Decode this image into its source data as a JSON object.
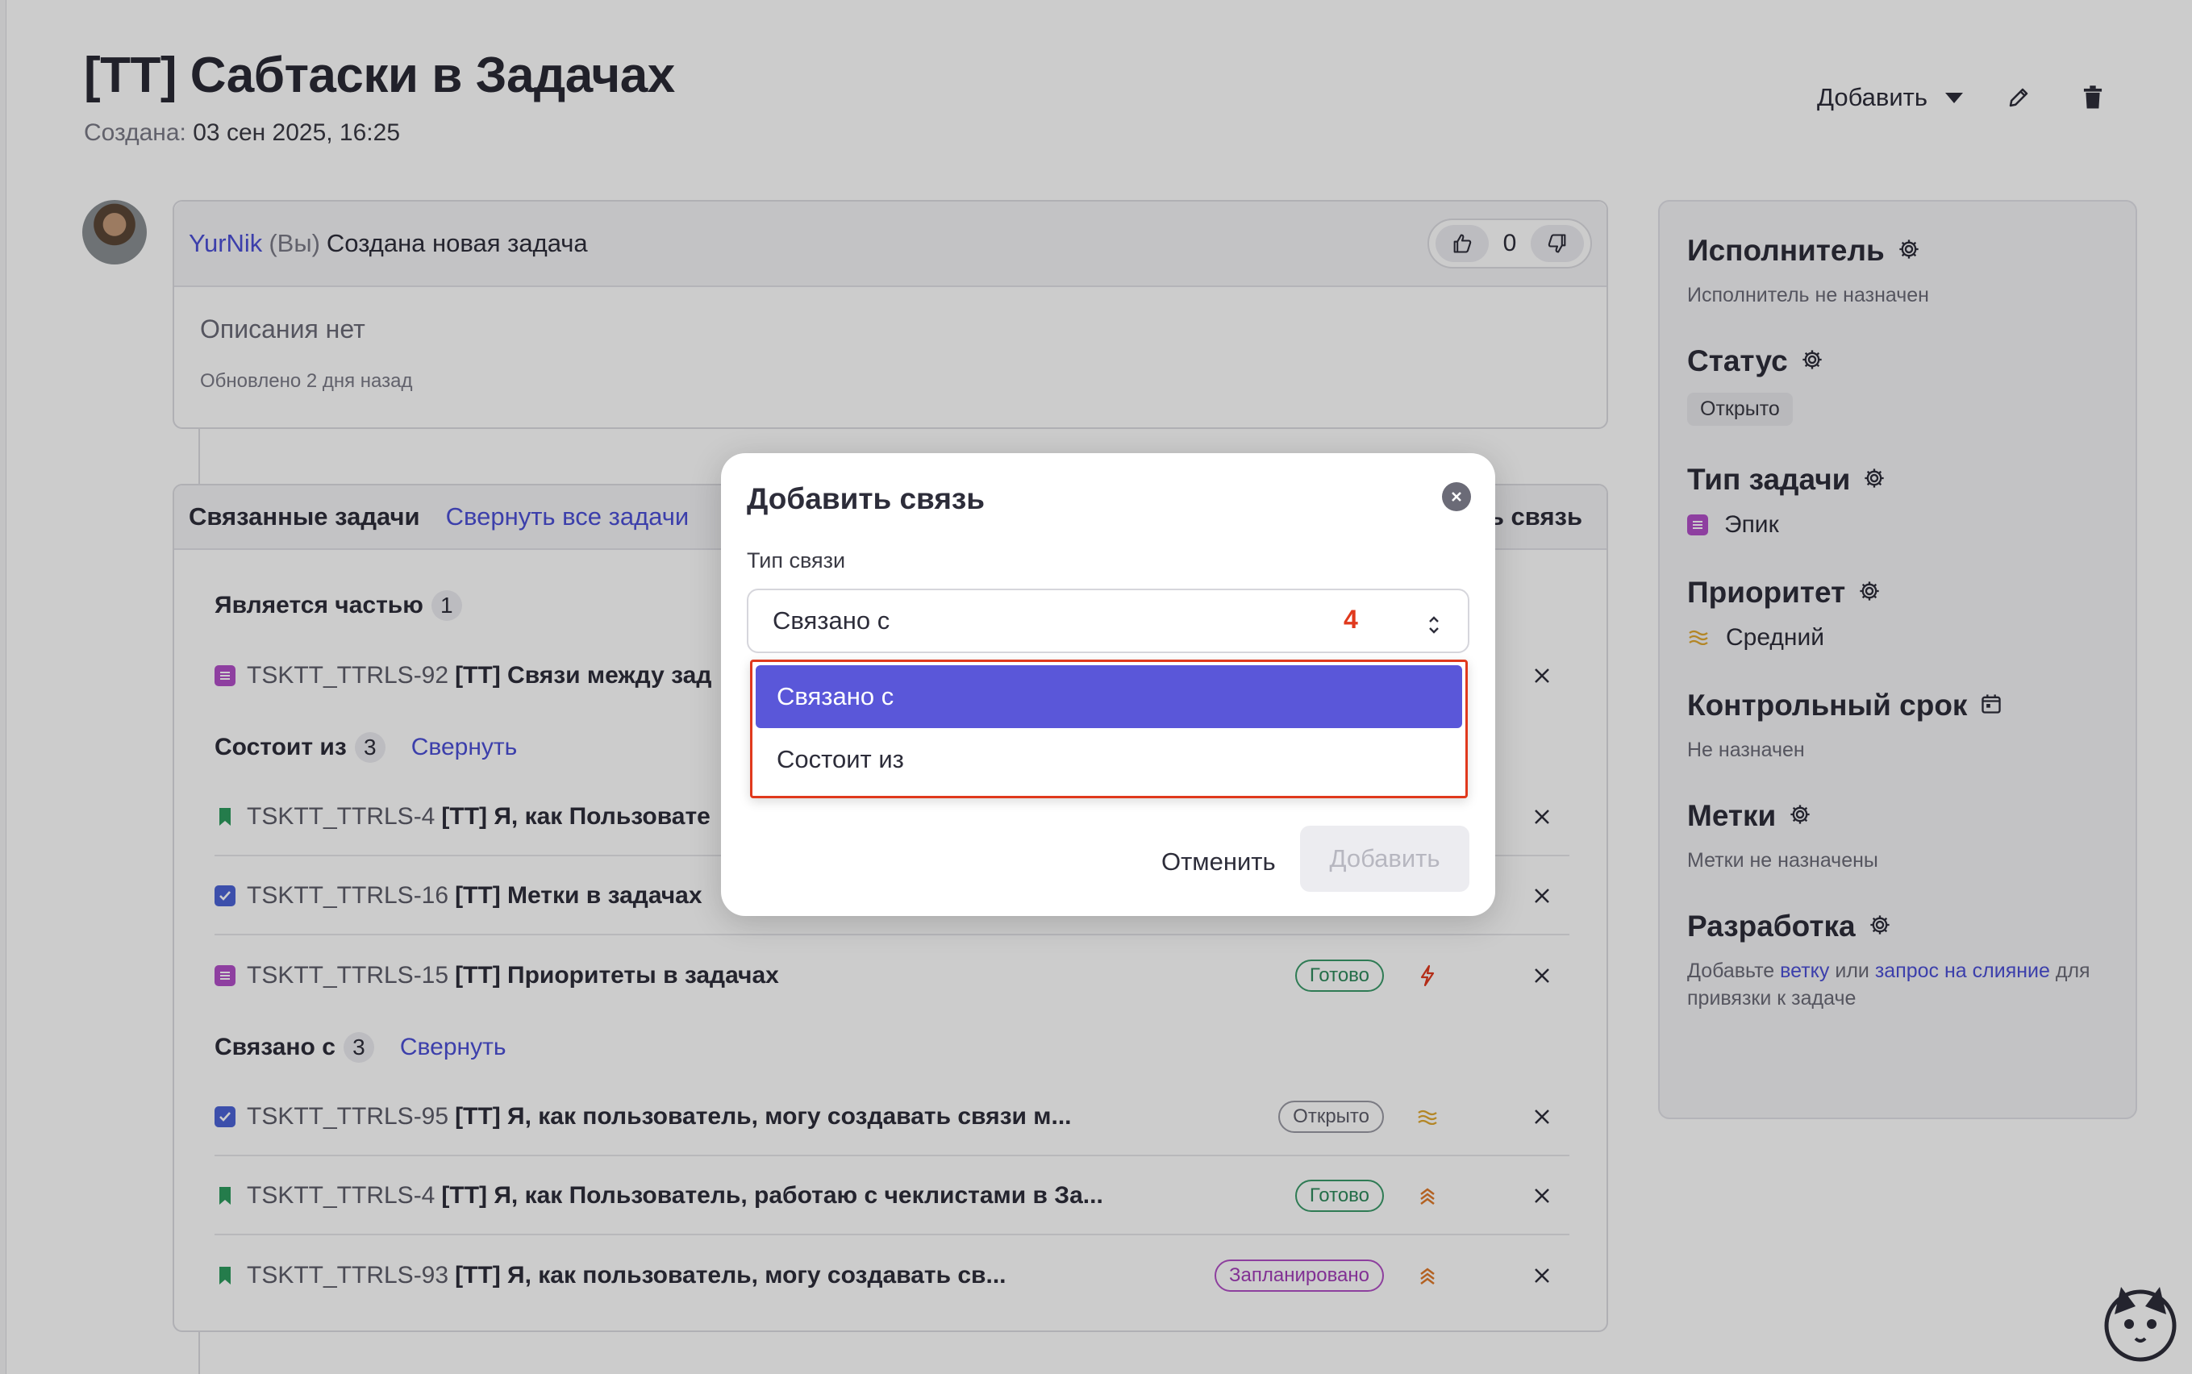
{
  "header": {
    "title": "[TT] Сабтаски в Задачах",
    "created_label": "Создана:",
    "created_date": "03 сен 2025, 16:25",
    "add_label": "Добавить"
  },
  "comment": {
    "user": "YurNik",
    "you": "(Вы)",
    "text": "Создана новая задача",
    "votes": "0",
    "no_description": "Описания нет",
    "updated": "Обновлено 2 дня назад"
  },
  "related": {
    "title": "Связанные задачи",
    "collapse_all": "Свернуть все задачи",
    "add_link": "ть связь",
    "groups": [
      {
        "label": "Является частью",
        "count": "1",
        "toggle": ""
      },
      {
        "label": "Состоит из",
        "count": "3",
        "toggle": "Свернуть"
      },
      {
        "label": "Связано с",
        "count": "3",
        "toggle": "Свернуть"
      }
    ],
    "rows": [
      {
        "code": "TSKTT_TTRLS-92",
        "name": "[TT] Связи между зад",
        "status": "",
        "type": "epic"
      },
      {
        "code": "TSKTT_TTRLS-4",
        "name": "[TT] Я, как Пользовате",
        "status": "",
        "type": "story"
      },
      {
        "code": "TSKTT_TTRLS-16",
        "name": "[TT] Метки в задачах",
        "status": "",
        "type": "task"
      },
      {
        "code": "TSKTT_TTRLS-15",
        "name": "[TT] Приоритеты в задачах",
        "status": "Готово",
        "type": "epic"
      },
      {
        "code": "TSKTT_TTRLS-95",
        "name": "[TT] Я, как пользователь, могу создавать связи м...",
        "status": "Открыто",
        "type": "task"
      },
      {
        "code": "TSKTT_TTRLS-4",
        "name": "[TT] Я, как Пользователь, работаю с чеклистами в За...",
        "status": "Готово",
        "type": "story"
      },
      {
        "code": "TSKTT_TTRLS-93",
        "name": "[TT] Я, как пользователь, могу создавать св...",
        "status": "Запланировано",
        "type": "story"
      }
    ]
  },
  "sidebar": {
    "assignee_title": "Исполнитель",
    "assignee_value": "Исполнитель не назначен",
    "status_title": "Статус",
    "status_value": "Открыто",
    "type_title": "Тип задачи",
    "type_value": "Эпик",
    "priority_title": "Приоритет",
    "priority_value": "Средний",
    "due_title": "Контрольный срок",
    "due_value": "Не назначен",
    "labels_title": "Метки",
    "labels_value": "Метки не назначены",
    "dev_title": "Разработка",
    "dev_prefix": "Добавьте",
    "dev_branch": "ветку",
    "dev_or": "или",
    "dev_mr": "запрос на слияние",
    "dev_suffix": "для привязки к задаче"
  },
  "modal": {
    "title": "Добавить связь",
    "field_label": "Тип связи",
    "selected": "Связано с",
    "marker": "4",
    "options": [
      "Связано с",
      "Состоит из"
    ],
    "cancel": "Отменить",
    "submit": "Добавить"
  },
  "colors": {
    "accent": "#4b4fd6",
    "selected_option": "#5a57d9",
    "highlight": "#e0391d",
    "done": "#2f8a5c",
    "planned": "#a23db8"
  }
}
